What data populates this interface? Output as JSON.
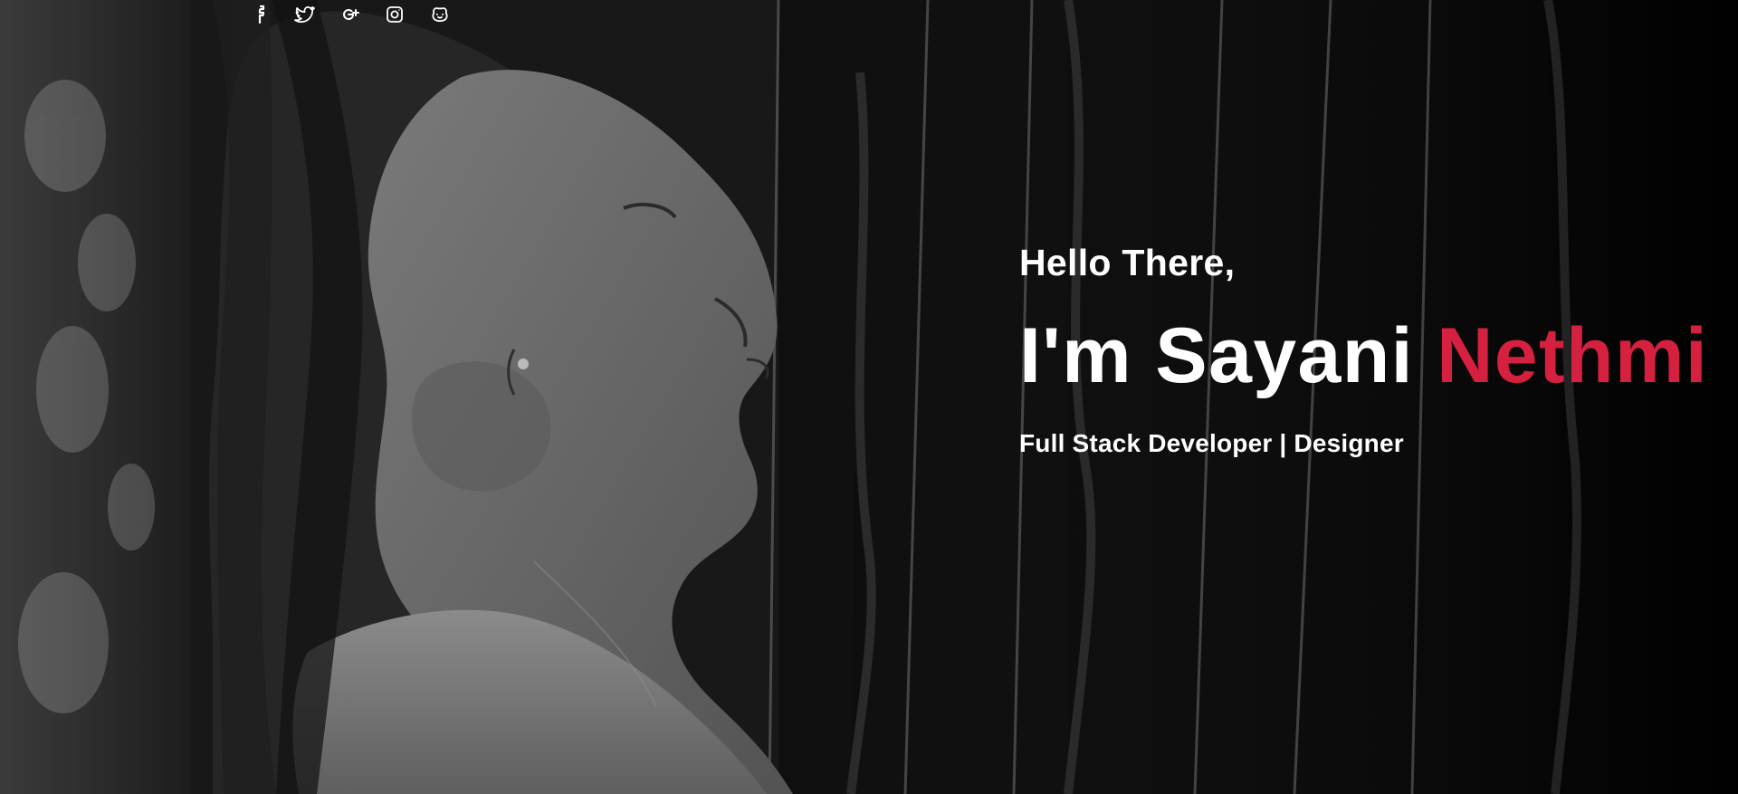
{
  "hero": {
    "greeting": "Hello There,",
    "name_prefix": "I'm Sayani",
    "name_accent": "Nethmi",
    "subtitle": "Full Stack Developer | Designer"
  },
  "social": {
    "items": [
      {
        "name": "facebook",
        "icon": "facebook-icon",
        "label": "f"
      },
      {
        "name": "twitter",
        "icon": "twitter-icon",
        "label": "twitter"
      },
      {
        "name": "google-plus",
        "icon": "google-plus-icon",
        "label": "g+"
      },
      {
        "name": "instagram",
        "icon": "instagram-icon",
        "label": "instagram"
      },
      {
        "name": "github",
        "icon": "github-icon",
        "label": "github"
      }
    ]
  },
  "colors": {
    "accent": "#d6203f",
    "text": "#ffffff"
  }
}
